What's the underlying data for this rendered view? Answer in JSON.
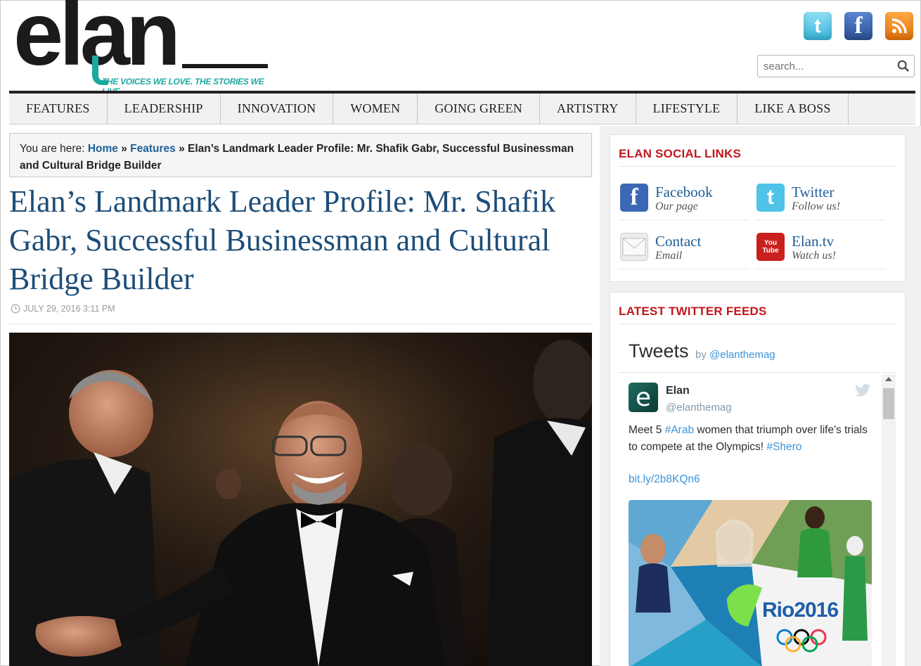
{
  "site": {
    "logo_text": "elan",
    "tagline": "THE VOICES WE LOVE. THE STORIES WE LIVE."
  },
  "header_social": [
    {
      "name": "twitter-icon",
      "glyph": "t"
    },
    {
      "name": "facebook-icon",
      "glyph": "f"
    },
    {
      "name": "rss-icon",
      "glyph": "RSS"
    }
  ],
  "search": {
    "placeholder": "search..."
  },
  "nav": [
    "FEATURES",
    "LEADERSHIP",
    "INNOVATION",
    "WOMEN",
    "GOING GREEN",
    "ARTISTRY",
    "LIFESTYLE",
    "LIKE A BOSS"
  ],
  "breadcrumb": {
    "prefix": "You are here:",
    "home": "Home",
    "sep1": "»",
    "features": "Features",
    "sep2": "»",
    "current": "Elan’s Landmark Leader Profile: Mr. Shafik Gabr, Successful Businessman and Cultural Bridge Builder"
  },
  "article": {
    "title": "Elan’s Landmark Leader Profile: Mr. Shafik Gabr, Successful Businessman and Cultural Bridge Builder",
    "date": "JULY 29, 2016 3:11 PM"
  },
  "social_widget": {
    "title": "ELAN SOCIAL LINKS",
    "links": [
      {
        "name": "Facebook",
        "sub": "Our page",
        "icon": "facebook-icon",
        "glyph": "f",
        "color": "#3b68b5"
      },
      {
        "name": "Twitter",
        "sub": "Follow us!",
        "icon": "twitter-icon",
        "glyph": "t",
        "color": "#4fc3e8"
      },
      {
        "name": "Contact",
        "sub": "Email",
        "icon": "envelope-icon",
        "glyph": "✉",
        "color": "#e6e6e6"
      },
      {
        "name": "Elan.tv",
        "sub": "Watch us!",
        "icon": "youtube-icon",
        "glyph": "You Tube",
        "color": "#c9201d"
      }
    ]
  },
  "twitter_widget": {
    "title": "LATEST TWITTER FEEDS",
    "header": "Tweets",
    "by": "by",
    "by_handle": "@elanthemag",
    "tweet": {
      "avatar_letter": "e",
      "name": "Elan",
      "handle": "@elanthemag",
      "text_1": "Meet 5 ",
      "hashtag_1": "#Arab",
      "text_2": " women that triumph over life's trials to compete at the Olympics! ",
      "hashtag_2": "#Shero",
      "link": "bit.ly/2b8KQn6",
      "media_label": "Rio2016"
    }
  }
}
